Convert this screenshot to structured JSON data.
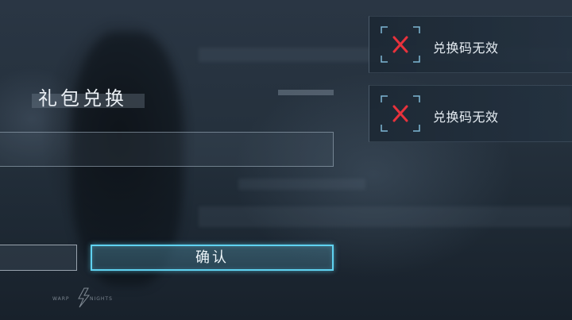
{
  "dialog": {
    "title": "礼包兑换",
    "code_input_value": "",
    "confirm_label": "确认",
    "cancel_label": ""
  },
  "toasts": [
    {
      "message": "兑换码无效",
      "icon": "error-x-icon"
    },
    {
      "message": "兑换码无效",
      "icon": "error-x-icon"
    }
  ],
  "branding": {
    "logo_text": "WARP KNIGHTS"
  },
  "colors": {
    "accent": "#5fd2f0",
    "error": "#e8323c",
    "text": "#e9eef3"
  }
}
